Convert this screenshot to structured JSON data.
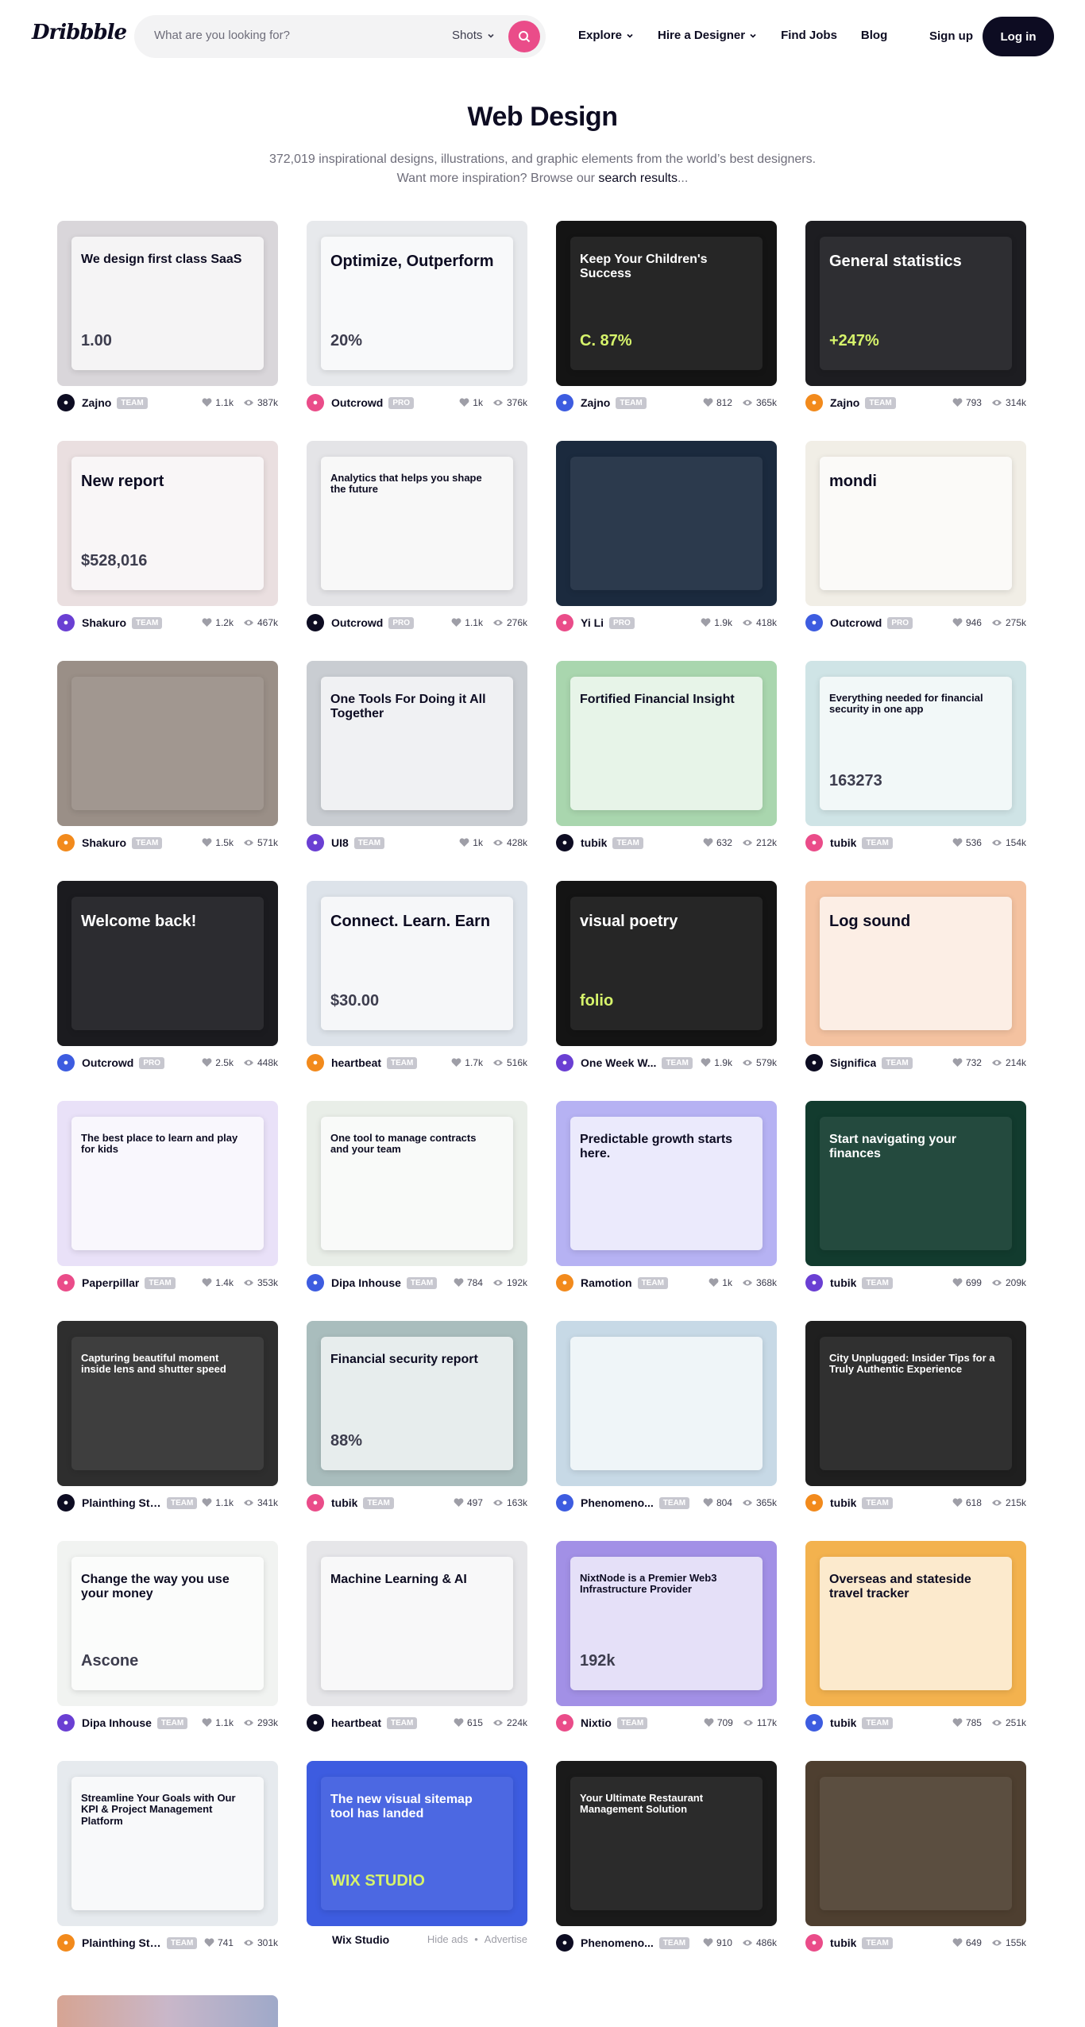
{
  "nav": {
    "logo": "Dribbble",
    "search_placeholder": "What are you looking for?",
    "search_filter": "Shots",
    "links": [
      {
        "label": "Explore",
        "dropdown": true
      },
      {
        "label": "Hire a Designer",
        "dropdown": true
      },
      {
        "label": "Find Jobs",
        "dropdown": false
      },
      {
        "label": "Blog",
        "dropdown": false
      }
    ],
    "signup": "Sign up",
    "login": "Log in",
    "accent": "#ea4c89"
  },
  "header": {
    "title": "Web Design",
    "subtitle": "372,019 inspirational designs, illustrations, and graphic elements from the world’s best designers.",
    "more_prefix": "Want more inspiration? Browse our ",
    "more_link": "search results",
    "more_suffix": "..."
  },
  "shots": [
    {
      "author": "Zajno",
      "badge": "TEAM",
      "likes": "1.1k",
      "views": "387k",
      "thumb_text": "We design first class SaaS",
      "thumb_text2": "1.00",
      "bg": "#d9d6da"
    },
    {
      "author": "Outcrowd",
      "badge": "PRO",
      "likes": "1k",
      "views": "376k",
      "thumb_text": "Optimize, Outperform",
      "thumb_text2": "20%",
      "bg": "#e7e9ec"
    },
    {
      "author": "Zajno",
      "badge": "TEAM",
      "likes": "812",
      "views": "365k",
      "thumb_text": "Keep Your Children's Success",
      "thumb_text2": "C. 87%",
      "bg": "#141414"
    },
    {
      "author": "Zajno",
      "badge": "TEAM",
      "likes": "793",
      "views": "314k",
      "thumb_text": "General statistics",
      "thumb_text2": "+247%",
      "bg": "#1d1d21"
    },
    {
      "author": "Shakuro",
      "badge": "TEAM",
      "likes": "1.2k",
      "views": "467k",
      "thumb_text": "New report",
      "thumb_text2": "$528,016",
      "bg": "#eadfe0"
    },
    {
      "author": "Outcrowd",
      "badge": "PRO",
      "likes": "1.1k",
      "views": "276k",
      "thumb_text": "Analytics that helps you shape the future",
      "thumb_text2": "",
      "bg": "#e4e4e7"
    },
    {
      "author": "Yi Li",
      "badge": "PRO",
      "likes": "1.9k",
      "views": "418k",
      "thumb_text": "",
      "thumb_text2": "",
      "bg": "#1b2a3e"
    },
    {
      "author": "Outcrowd",
      "badge": "PRO",
      "likes": "946",
      "views": "275k",
      "thumb_text": "mondi",
      "thumb_text2": "",
      "bg": "#f1eee6"
    },
    {
      "author": "Shakuro",
      "badge": "TEAM",
      "likes": "1.5k",
      "views": "571k",
      "thumb_text": "",
      "thumb_text2": "",
      "bg": "#9a8f87"
    },
    {
      "author": "UI8",
      "badge": "TEAM",
      "likes": "1k",
      "views": "428k",
      "thumb_text": "One Tools For Doing it All Together",
      "thumb_text2": "",
      "bg": "#c9cdd2"
    },
    {
      "author": "tubik",
      "badge": "TEAM",
      "likes": "632",
      "views": "212k",
      "thumb_text": "Fortified Financial Insight",
      "thumb_text2": "",
      "bg": "#a9d6ae"
    },
    {
      "author": "tubik",
      "badge": "TEAM",
      "likes": "536",
      "views": "154k",
      "thumb_text": "Everything needed for financial security in one app",
      "thumb_text2": "163273",
      "bg": "#cfe4e6"
    },
    {
      "author": "Outcrowd",
      "badge": "PRO",
      "likes": "2.5k",
      "views": "448k",
      "thumb_text": "Welcome back!",
      "thumb_text2": "",
      "bg": "#1b1b1f"
    },
    {
      "author": "heartbeat",
      "badge": "TEAM",
      "likes": "1.7k",
      "views": "516k",
      "thumb_text": "Connect. Learn. Earn",
      "thumb_text2": "$30.00",
      "bg": "#dde3ea"
    },
    {
      "author": "One Week W...",
      "badge": "TEAM",
      "likes": "1.9k",
      "views": "579k",
      "thumb_text": "visual poetry",
      "thumb_text2": "folio",
      "bg": "#141414"
    },
    {
      "author": "Significa",
      "badge": "TEAM",
      "likes": "732",
      "views": "214k",
      "thumb_text": "Log sound",
      "thumb_text2": "",
      "bg": "#f4c2a0"
    },
    {
      "author": "Paperpillar",
      "badge": "TEAM",
      "likes": "1.4k",
      "views": "353k",
      "thumb_text": "The best place to learn and play for kids",
      "thumb_text2": "",
      "bg": "#e9e1f8"
    },
    {
      "author": "Dipa Inhouse",
      "badge": "TEAM",
      "likes": "784",
      "views": "192k",
      "thumb_text": "One tool to manage contracts and your team",
      "thumb_text2": "",
      "bg": "#e9eee8"
    },
    {
      "author": "Ramotion",
      "badge": "TEAM",
      "likes": "1k",
      "views": "368k",
      "thumb_text": "Predictable growth starts here.",
      "thumb_text2": "",
      "bg": "#b6b2f3"
    },
    {
      "author": "tubik",
      "badge": "TEAM",
      "likes": "699",
      "views": "209k",
      "thumb_text": "Start navigating your finances",
      "thumb_text2": "",
      "bg": "#123b2e"
    },
    {
      "author": "Plainthing Stu...",
      "badge": "TEAM",
      "likes": "1.1k",
      "views": "341k",
      "thumb_text": "Capturing beautiful moment inside lens and shutter speed",
      "thumb_text2": "",
      "bg": "#2e2e2e"
    },
    {
      "author": "tubik",
      "badge": "TEAM",
      "likes": "497",
      "views": "163k",
      "thumb_text": "Financial security report",
      "thumb_text2": "88%",
      "bg": "#a9bdbd"
    },
    {
      "author": "Phenomeno...",
      "badge": "TEAM",
      "likes": "804",
      "views": "365k",
      "thumb_text": "",
      "thumb_text2": "",
      "bg": "#c7d9e6"
    },
    {
      "author": "tubik",
      "badge": "TEAM",
      "likes": "618",
      "views": "215k",
      "thumb_text": "City Unplugged: Insider Tips for a Truly Authentic Experience",
      "thumb_text2": "",
      "bg": "#1f1f1f"
    },
    {
      "author": "Dipa Inhouse",
      "badge": "TEAM",
      "likes": "1.1k",
      "views": "293k",
      "thumb_text": "Change the way you use your money",
      "thumb_text2": "Ascone",
      "bg": "#f1f3f1"
    },
    {
      "author": "heartbeat",
      "badge": "TEAM",
      "likes": "615",
      "views": "224k",
      "thumb_text": "Machine Learning & AI",
      "thumb_text2": "",
      "bg": "#e6e6e9"
    },
    {
      "author": "Nixtio",
      "badge": "TEAM",
      "likes": "709",
      "views": "117k",
      "thumb_text": "NixtNode is a Premier Web3 Infrastructure Provider",
      "thumb_text2": "192k",
      "bg": "#a290e6"
    },
    {
      "author": "tubik",
      "badge": "TEAM",
      "likes": "785",
      "views": "251k",
      "thumb_text": "Overseas and stateside travel tracker",
      "thumb_text2": "",
      "bg": "#f3b24e"
    },
    {
      "author": "Plainthing Stu...",
      "badge": "TEAM",
      "likes": "741",
      "views": "301k",
      "thumb_text": "Streamline Your Goals with Our KPI & Project Management Platform",
      "thumb_text2": "",
      "bg": "#e6eaee"
    },
    {
      "ad": true,
      "author": "Wix Studio",
      "hide": "Hide ads",
      "advertise": "Advertise",
      "thumb_text": "The new visual sitemap tool has landed",
      "thumb_text2": "WIX STUDIO",
      "bg": "#3d5ce0"
    },
    {
      "author": "Phenomeno...",
      "badge": "TEAM",
      "likes": "910",
      "views": "486k",
      "thumb_text": "Your Ultimate Restaurant Management Solution",
      "thumb_text2": "",
      "bg": "#1a1a1a"
    },
    {
      "author": "tubik",
      "badge": "TEAM",
      "likes": "649",
      "views": "155k",
      "thumb_text": "",
      "thumb_text2": "",
      "bg": "#4e3f30"
    }
  ]
}
